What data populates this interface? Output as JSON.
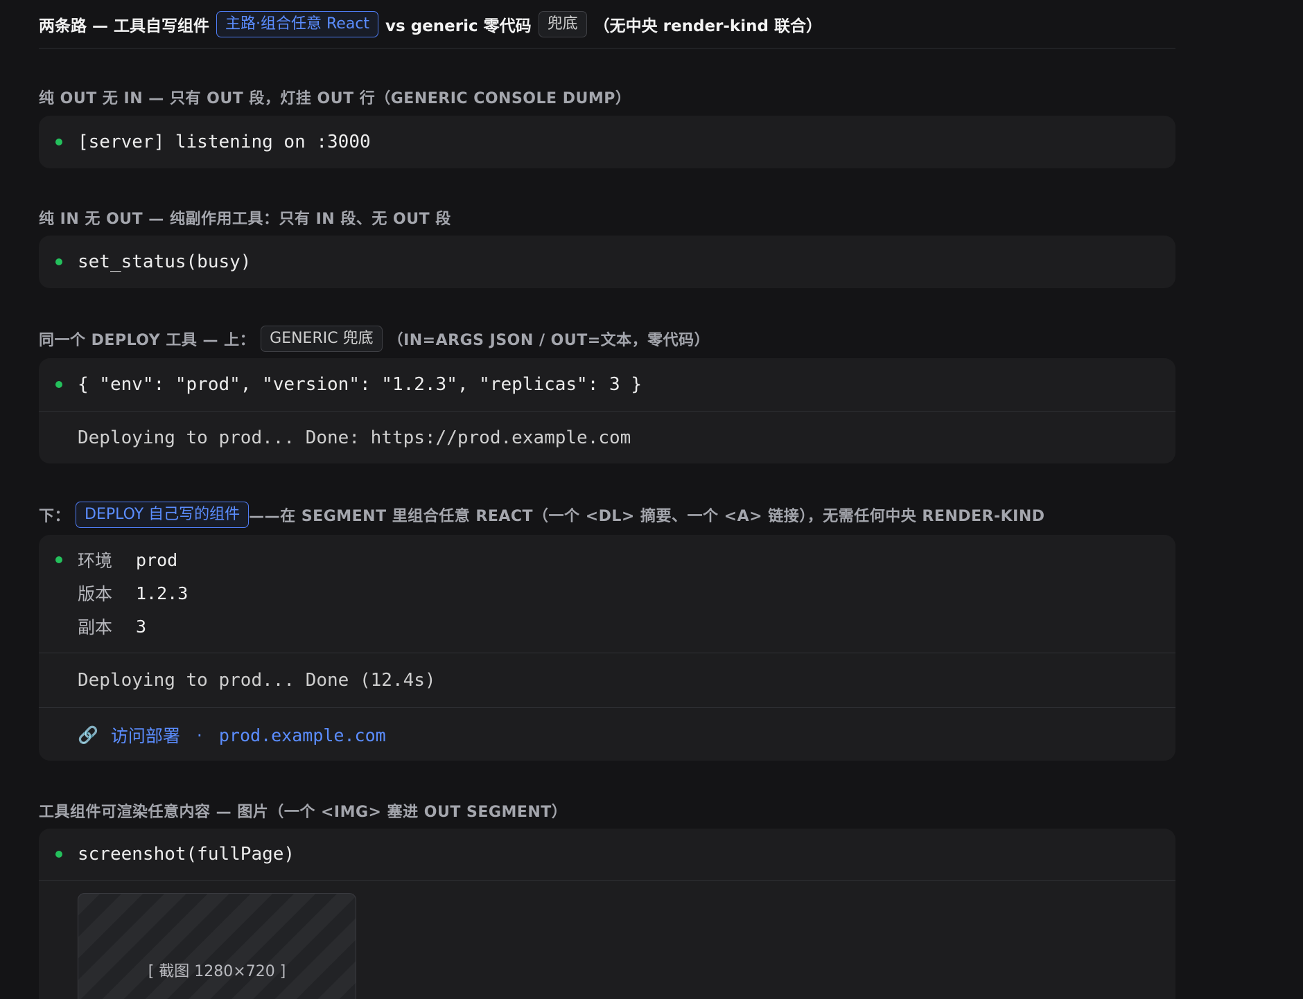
{
  "header": {
    "prefix": "两条路 — 工具自写组件",
    "pill_main": "主路·组合任意 React",
    "vs_text": "vs generic 零代码",
    "pill_fallback": "兜底",
    "suffix": "（无中央 render-kind 联合）"
  },
  "sections": {
    "out_only": {
      "label": "纯 OUT 无 IN — 只有 OUT 段，灯挂 OUT 行（GENERIC CONSOLE DUMP）",
      "line": "[server] listening on :3000"
    },
    "in_only": {
      "label": "纯 IN 无 OUT — 纯副作用工具：只有 IN 段、无 OUT 段",
      "line": "set_status(busy)"
    },
    "generic": {
      "label_prefix": "同一个 DEPLOY 工具 — 上：",
      "pill": "GENERIC 兜底",
      "label_suffix": "（IN=ARGS JSON / OUT=文本，零代码）",
      "in_line": "{ \"env\": \"prod\", \"version\": \"1.2.3\", \"replicas\": 3 }",
      "out_line": "Deploying to prod... Done: https://prod.example.com"
    },
    "custom": {
      "label_prefix": "下：",
      "pill": "DEPLOY 自己写的组件",
      "label_suffix": "——在 SEGMENT 里组合任意 REACT（一个 <DL> 摘要、一个 <A> 链接），无需任何中央 RENDER-KIND",
      "summary": [
        {
          "key": "环境",
          "value": "prod"
        },
        {
          "key": "版本",
          "value": "1.2.3"
        },
        {
          "key": "副本",
          "value": "3"
        }
      ],
      "log_line": "Deploying to prod... Done (12.4s)",
      "link_icon": "🔗",
      "link_text": "访问部署",
      "link_sep": "·",
      "link_host": "prod.example.com",
      "accent_color": "#5b8dff"
    },
    "image": {
      "label": "工具组件可渲染任意内容 — 图片（一个 <IMG> 塞进 OUT SEGMENT）",
      "in_line": "screenshot(fullPage)",
      "placeholder": "[ 截图 1280×720 ]"
    }
  },
  "colors": {
    "background": "#141416",
    "card": "#1d1d1f",
    "status_dot": "#24c05c",
    "accent": "#5b8dff"
  },
  "icons": {
    "status": "green-dot-icon",
    "link": "chain-link-icon"
  }
}
